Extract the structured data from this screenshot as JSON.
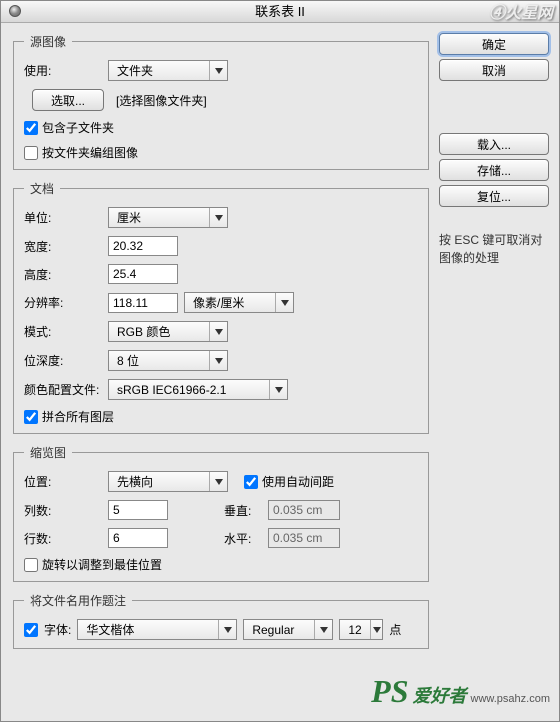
{
  "title": "联系表 II",
  "watermark_top": "④火星网",
  "watermark_ps": "PS",
  "watermark_text": "爱好者",
  "watermark_url": "www.psahz.com",
  "source": {
    "legend": "源图像",
    "use_label": "使用:",
    "use_value": "文件夹",
    "choose_btn": "选取...",
    "choose_hint": "[选择图像文件夹]",
    "include_sub_label": "包含子文件夹",
    "group_by_folder_label": "按文件夹编组图像"
  },
  "doc": {
    "legend": "文档",
    "unit_label": "单位:",
    "unit_value": "厘米",
    "width_label": "宽度:",
    "width_value": "20.32",
    "height_label": "高度:",
    "height_value": "25.4",
    "res_label": "分辨率:",
    "res_value": "118.11",
    "res_unit": "像素/厘米",
    "mode_label": "模式:",
    "mode_value": "RGB 颜色",
    "depth_label": "位深度:",
    "depth_value": "8 位",
    "profile_label": "颜色配置文件:",
    "profile_value": "sRGB IEC61966-2.1",
    "flatten_label": "拼合所有图层"
  },
  "thumb": {
    "legend": "缩览图",
    "place_label": "位置:",
    "place_value": "先横向",
    "auto_space_label": "使用自动间距",
    "cols_label": "列数:",
    "cols_value": "5",
    "rows_label": "行数:",
    "rows_value": "6",
    "vert_label": "垂直:",
    "vert_value": "0.035 cm",
    "horz_label": "水平:",
    "horz_value": "0.035 cm",
    "rotate_label": "旋转以调整到最佳位置"
  },
  "caption": {
    "legend": "将文件名用作题注",
    "font_label": "字体:",
    "font_value": "华文楷体",
    "style_value": "Regular",
    "size_value": "12",
    "pt_label": "点"
  },
  "buttons": {
    "ok": "确定",
    "cancel": "取消",
    "load": "载入...",
    "save": "存储...",
    "reset": "复位..."
  },
  "hint": "按 ESC 键可取消对图像的处理"
}
